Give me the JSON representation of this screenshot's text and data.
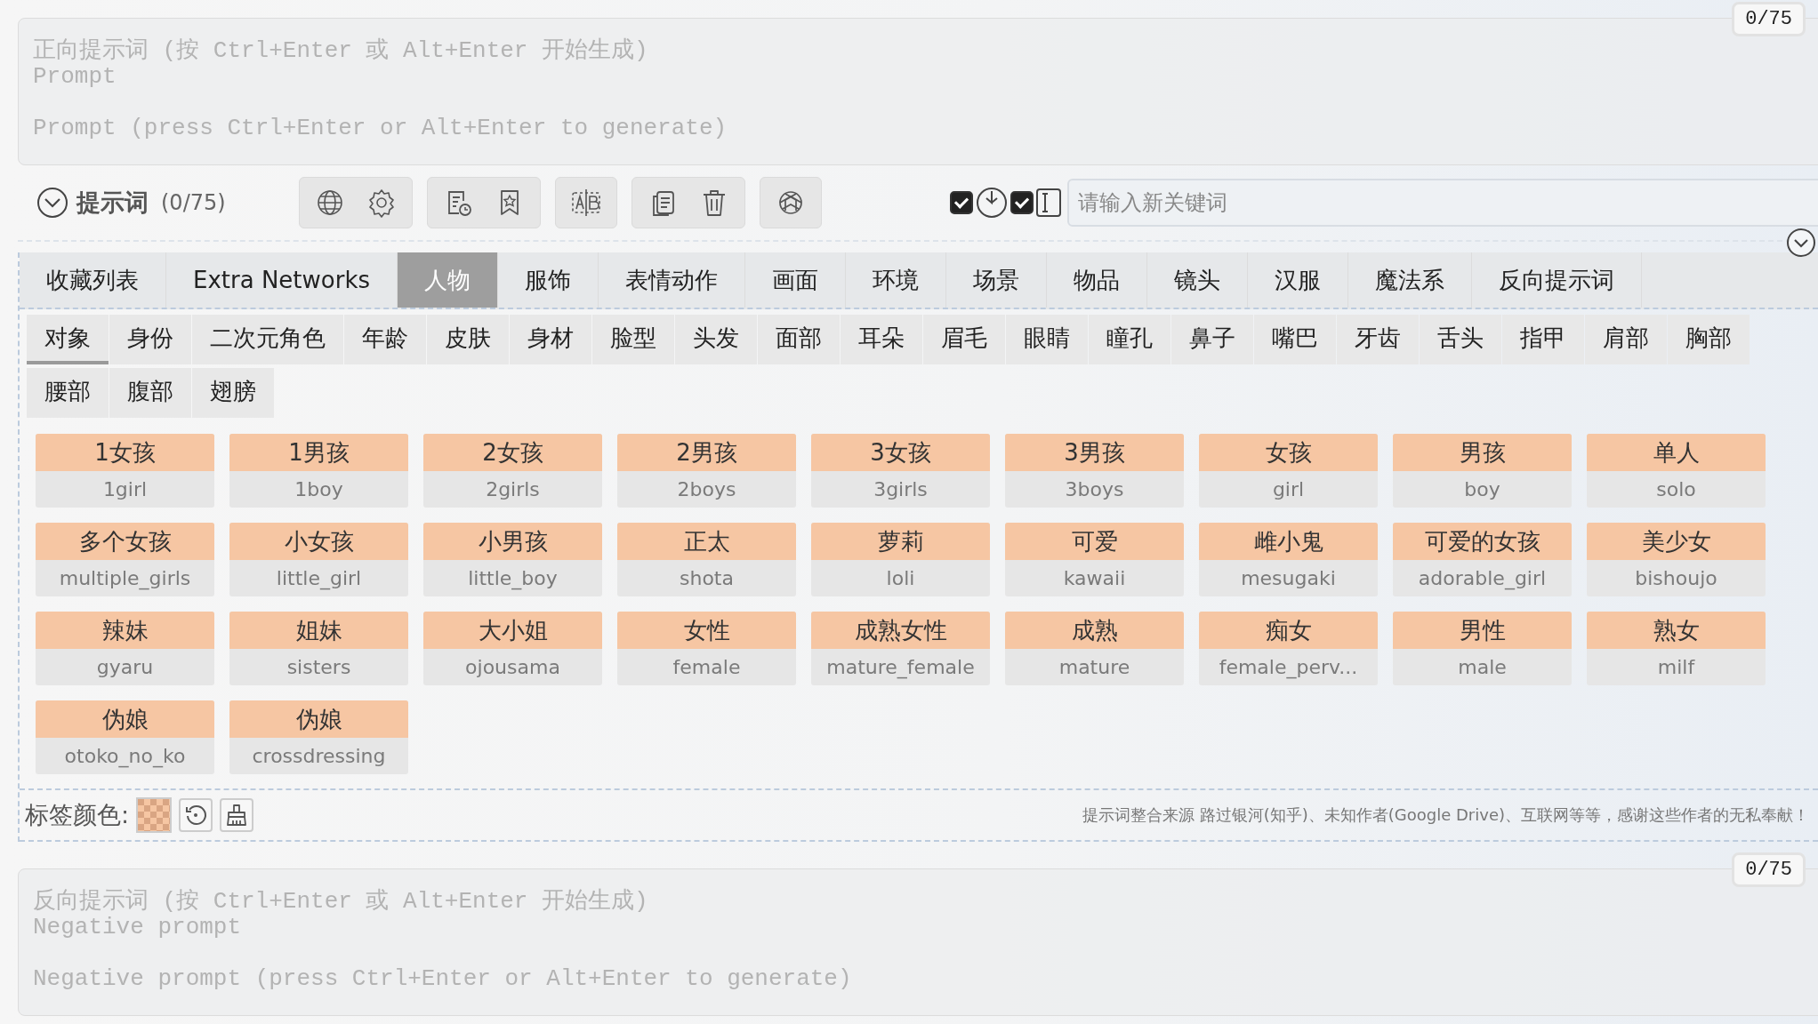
{
  "prompt": {
    "placeholder": "正向提示词 (按 Ctrl+Enter 或 Alt+Enter 开始生成)\nPrompt\n\nPrompt (press Ctrl+Enter or Alt+Enter to generate)",
    "counter": "0/75"
  },
  "toolbar": {
    "title": "提示词",
    "count": "(0/75)",
    "checks": [
      {
        "checked": true
      },
      {
        "checked": true
      }
    ],
    "keyword_placeholder": "请输入新关键词"
  },
  "tabs": [
    {
      "label": "收藏列表",
      "selected": false
    },
    {
      "label": "Extra Networks",
      "selected": false
    },
    {
      "label": "人物",
      "selected": true
    },
    {
      "label": "服饰",
      "selected": false
    },
    {
      "label": "表情动作",
      "selected": false
    },
    {
      "label": "画面",
      "selected": false
    },
    {
      "label": "环境",
      "selected": false
    },
    {
      "label": "场景",
      "selected": false
    },
    {
      "label": "物品",
      "selected": false
    },
    {
      "label": "镜头",
      "selected": false
    },
    {
      "label": "汉服",
      "selected": false
    },
    {
      "label": "魔法系",
      "selected": false
    },
    {
      "label": "反向提示词",
      "selected": false
    }
  ],
  "subtabs": [
    {
      "label": "对象",
      "selected": true
    },
    {
      "label": "身份",
      "selected": false
    },
    {
      "label": "二次元角色",
      "selected": false
    },
    {
      "label": "年龄",
      "selected": false
    },
    {
      "label": "皮肤",
      "selected": false
    },
    {
      "label": "身材",
      "selected": false
    },
    {
      "label": "脸型",
      "selected": false
    },
    {
      "label": "头发",
      "selected": false
    },
    {
      "label": "面部",
      "selected": false
    },
    {
      "label": "耳朵",
      "selected": false
    },
    {
      "label": "眉毛",
      "selected": false
    },
    {
      "label": "眼睛",
      "selected": false
    },
    {
      "label": "瞳孔",
      "selected": false
    },
    {
      "label": "鼻子",
      "selected": false
    },
    {
      "label": "嘴巴",
      "selected": false
    },
    {
      "label": "牙齿",
      "selected": false
    },
    {
      "label": "舌头",
      "selected": false
    },
    {
      "label": "指甲",
      "selected": false
    },
    {
      "label": "肩部",
      "selected": false
    },
    {
      "label": "胸部",
      "selected": false
    },
    {
      "label": "腰部",
      "selected": false
    },
    {
      "label": "腹部",
      "selected": false
    },
    {
      "label": "翅膀",
      "selected": false
    }
  ],
  "tags": [
    {
      "zh": "1女孩",
      "en": "1girl"
    },
    {
      "zh": "1男孩",
      "en": "1boy"
    },
    {
      "zh": "2女孩",
      "en": "2girls"
    },
    {
      "zh": "2男孩",
      "en": "2boys"
    },
    {
      "zh": "3女孩",
      "en": "3girls"
    },
    {
      "zh": "3男孩",
      "en": "3boys"
    },
    {
      "zh": "女孩",
      "en": "girl"
    },
    {
      "zh": "男孩",
      "en": "boy"
    },
    {
      "zh": "单人",
      "en": "solo"
    },
    {
      "zh": "多个女孩",
      "en": "multiple_girls"
    },
    {
      "zh": "小女孩",
      "en": "little_girl"
    },
    {
      "zh": "小男孩",
      "en": "little_boy"
    },
    {
      "zh": "正太",
      "en": "shota"
    },
    {
      "zh": "萝莉",
      "en": "loli"
    },
    {
      "zh": "可爱",
      "en": "kawaii"
    },
    {
      "zh": "雌小鬼",
      "en": "mesugaki"
    },
    {
      "zh": "可爱的女孩",
      "en": "adorable_girl"
    },
    {
      "zh": "美少女",
      "en": "bishoujo"
    },
    {
      "zh": "辣妹",
      "en": "gyaru"
    },
    {
      "zh": "姐妹",
      "en": "sisters"
    },
    {
      "zh": "大小姐",
      "en": "ojousama"
    },
    {
      "zh": "女性",
      "en": "female"
    },
    {
      "zh": "成熟女性",
      "en": "mature_female"
    },
    {
      "zh": "成熟",
      "en": "mature"
    },
    {
      "zh": "痴女",
      "en": "female_perv..."
    },
    {
      "zh": "男性",
      "en": "male"
    },
    {
      "zh": "熟女",
      "en": "milf"
    },
    {
      "zh": "伪娘",
      "en": "otoko_no_ko"
    },
    {
      "zh": "伪娘",
      "en": "crossdressing"
    }
  ],
  "tag_bar": {
    "label": "标签颜色:",
    "credits": "提示词整合来源 路过银河(知乎)、未知作者(Google Drive)、互联网等等，感谢这些作者的无私奉献！"
  },
  "negative": {
    "placeholder": "反向提示词 (按 Ctrl+Enter 或 Alt+Enter 开始生成)\nNegative prompt\n\nNegative prompt (press Ctrl+Enter or Alt+Enter to generate)",
    "counter": "0/75"
  }
}
